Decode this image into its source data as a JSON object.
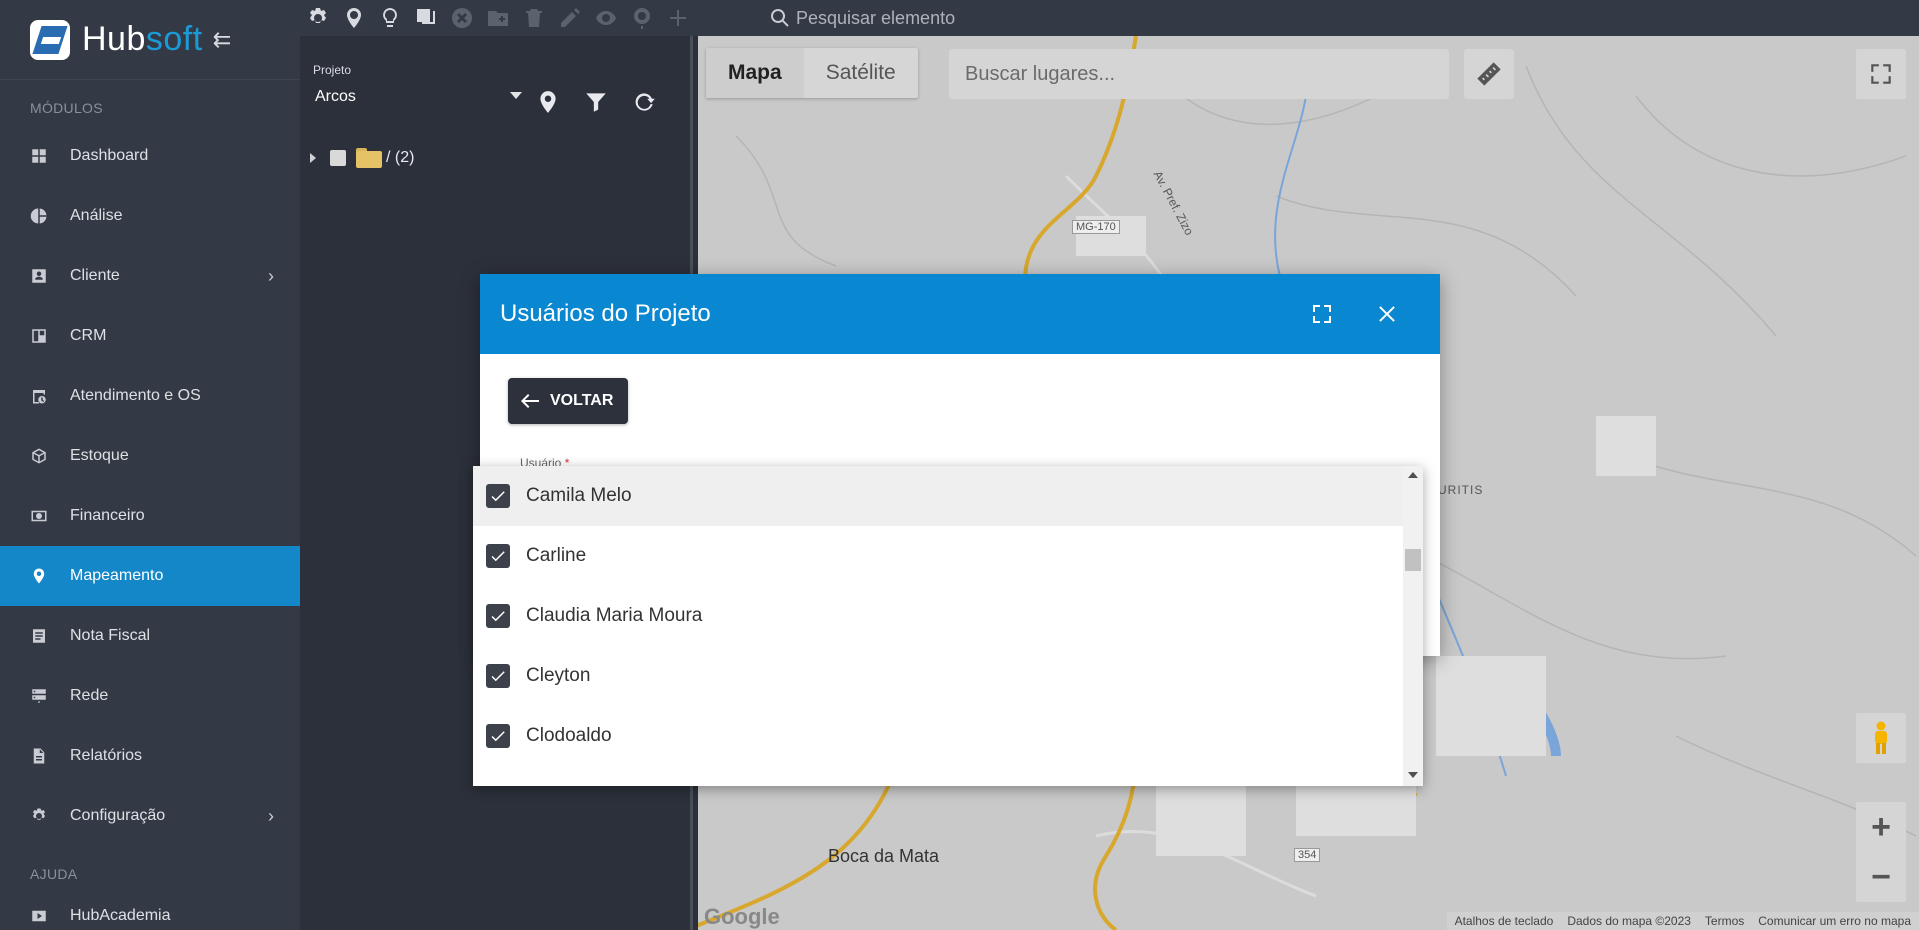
{
  "app": {
    "brand_part1": "Hub",
    "brand_part2": "soft"
  },
  "sidebar": {
    "section_modules": "MÓDULOS",
    "section_help": "AJUDA",
    "items": [
      {
        "label": "Dashboard",
        "icon": "dashboard-icon"
      },
      {
        "label": "Análise",
        "icon": "pie-chart-icon"
      },
      {
        "label": "Cliente",
        "icon": "client-card-icon",
        "has_children": true
      },
      {
        "label": "CRM",
        "icon": "crm-board-icon"
      },
      {
        "label": "Atendimento e OS",
        "icon": "calendar-clock-icon"
      },
      {
        "label": "Estoque",
        "icon": "box-icon"
      },
      {
        "label": "Financeiro",
        "icon": "money-icon"
      },
      {
        "label": "Mapeamento",
        "icon": "map-pin-icon",
        "active": true
      },
      {
        "label": "Nota Fiscal",
        "icon": "invoice-icon"
      },
      {
        "label": "Rede",
        "icon": "server-icon"
      },
      {
        "label": "Relatórios",
        "icon": "report-file-icon"
      },
      {
        "label": "Configuração",
        "icon": "gear-icon",
        "has_children": true
      }
    ],
    "help_items": [
      {
        "label": "HubAcademia",
        "icon": "video-icon"
      }
    ]
  },
  "topbar": {
    "search_placeholder": "Pesquisar elemento"
  },
  "panel": {
    "project_label": "Projeto",
    "project_value": "Arcos",
    "tree_root": "/ (2)"
  },
  "map": {
    "type_map": "Mapa",
    "type_satellite": "Satélite",
    "places_placeholder": "Buscar lugares...",
    "labels": {
      "road_mg170": "MG-170",
      "avenue": "Av. Pref. Zizo",
      "district": "BURITIS",
      "town": "Boca da Mata",
      "road_354": "354",
      "google": "Google"
    },
    "attribution": [
      "Atalhos de teclado",
      "Dados do mapa ©2023",
      "Termos",
      "Comunicar um erro no mapa"
    ]
  },
  "modal": {
    "title": "Usuários do Projeto",
    "back_label": "VOLTAR",
    "field_label": "Usuário",
    "required_mark": "*"
  },
  "dropdown": {
    "options": [
      {
        "label": "Camila Melo",
        "checked": true
      },
      {
        "label": "Carline",
        "checked": true
      },
      {
        "label": "Claudia Maria Moura",
        "checked": true
      },
      {
        "label": "Cleyton",
        "checked": true
      },
      {
        "label": "Clodoaldo",
        "checked": true
      }
    ]
  },
  "colors": {
    "accent": "#0a87d1",
    "sidebar_active": "#1487c8",
    "sidebar_bg": "#343a45"
  }
}
